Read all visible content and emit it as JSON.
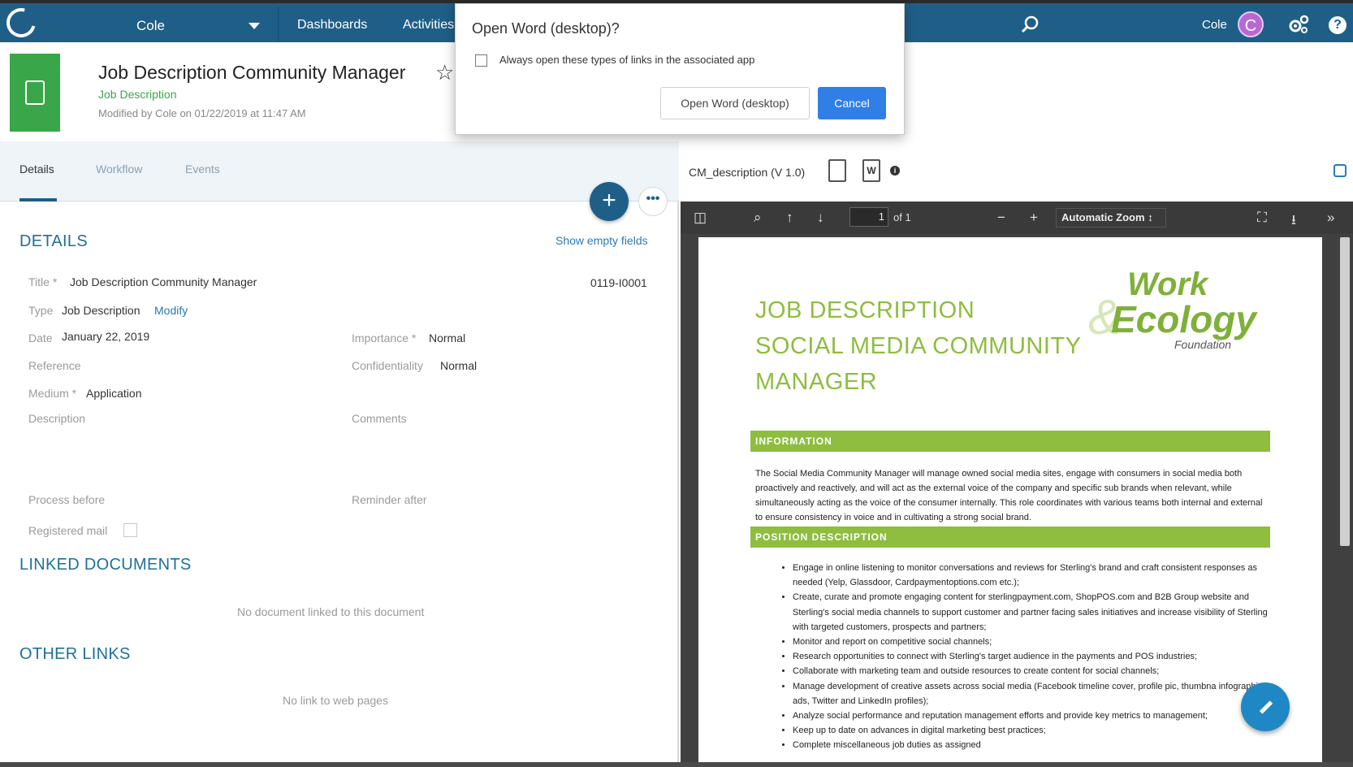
{
  "topbar": {
    "user_menu": "Cole",
    "nav": [
      "Dashboards",
      "Activities"
    ],
    "user_name": "Cole",
    "avatar_letter": "C",
    "help": "?",
    "brand_color": "#1f5f87",
    "avatar_color": "#b66ad1"
  },
  "document": {
    "title": "Job Description Community Manager",
    "type": "Job Description",
    "modified": "Modified by Cole on 01/22/2019 at 11:47 AM",
    "icon": "document-icon",
    "icon_color": "#3aa64a"
  },
  "tabs": [
    {
      "label": "Details",
      "active": true
    },
    {
      "label": "Workflow",
      "active": false
    },
    {
      "label": "Events",
      "active": false
    }
  ],
  "actions": {
    "add": "+",
    "more": "•••"
  },
  "details": {
    "heading": "DETAILS",
    "show_empty": "Show empty fields",
    "title_label": "Title *",
    "title_value": "Job Description Community Manager",
    "doc_number": "0119-I0001",
    "type_label": "Type",
    "type_value": "Job Description",
    "modify": "Modify",
    "date_label": "Date",
    "date_value": "January 22, 2019",
    "importance_label": "Importance *",
    "importance_value": "Normal",
    "reference_label": "Reference",
    "confidentiality_label": "Confidentiality",
    "confidentiality_value": "Normal",
    "medium_label": "Medium *",
    "medium_value": "Application",
    "description_label": "Description",
    "comments_label": "Comments",
    "process_before_label": "Process before",
    "reminder_after_label": "Reminder after",
    "registered_mail_label": "Registered mail",
    "registered_mail_checked": false
  },
  "linked_documents": {
    "heading": "LINKED DOCUMENTS",
    "empty": "No document linked to this document"
  },
  "other_links": {
    "heading": "OTHER LINKS",
    "empty": "No link to web pages"
  },
  "viewer": {
    "file_name": "CM_description (V 1.0)",
    "word_icon_letter": "W",
    "info": "i",
    "page_number": "1",
    "page_of": "of 1",
    "zoom": "Automatic Zoom",
    "zoom_caret": "↕",
    "sidebar_icon": "◫",
    "search_icon": "⌕",
    "prev_icon": "↑",
    "next_icon": "↓",
    "zoom_out": "−",
    "zoom_in": "+",
    "fullscreen_icon": "⛶",
    "save_icon": "⭳",
    "more_icon": "»"
  },
  "pdf": {
    "heading1": "JOB DESCRIPTION",
    "heading2": "SOCIAL MEDIA COMMUNITY",
    "heading3": "MANAGER",
    "brand_line1": "Work",
    "brand_amp": "&",
    "brand_line2": "Ecology",
    "brand_line3": "Foundation",
    "section1": "INFORMATION",
    "section1_text": "The Social Media Community Manager will manage owned social media sites, engage with consumers in social media both proactively and reactively, and will act as the external voice of the company and specific sub brands when relevant, while simultaneously acting as the voice of the consumer internally.  This role coordinates with various teams both internal and external to ensure consistency in voice and in cultivating a strong social brand.",
    "section2": "POSITION DESCRIPTION",
    "bullets": [
      "Engage in online listening to monitor conversations and reviews for Sterling's brand and craft consistent responses as needed (Yelp, Glassdoor, Cardpaymentoptions.com etc.);",
      "Create, curate and promote engaging content for sterlingpayment.com, ShopPOS.com and B2B Group website and Sterling's social media channels to support customer and partner facing sales initiatives and increase visibility of Sterling with targeted customers, prospects and partners;",
      "Monitor and report on competitive social channels;",
      "Research opportunities to connect with Sterling's target audience in the payments and POS industries;",
      "Collaborate with marketing team and outside resources to create content for social channels;",
      "Manage development of creative assets across social media (Facebook timeline cover, profile pic, thumbna infographics, ads, Twitter and LinkedIn profiles);",
      "Analyze social performance and reputation management efforts and provide key metrics to management;",
      "Keep up to date on advances in digital marketing best practices;",
      "Complete miscellaneous job duties as assigned"
    ],
    "accent_color": "#8ebd3f"
  },
  "dialog": {
    "title": "Open Word (desktop)?",
    "checkbox_label": "Always open these types of links in the associated app",
    "checkbox_checked": false,
    "open_button": "Open Word (desktop)",
    "cancel_button": "Cancel",
    "cancel_color": "#2f7fe6"
  }
}
